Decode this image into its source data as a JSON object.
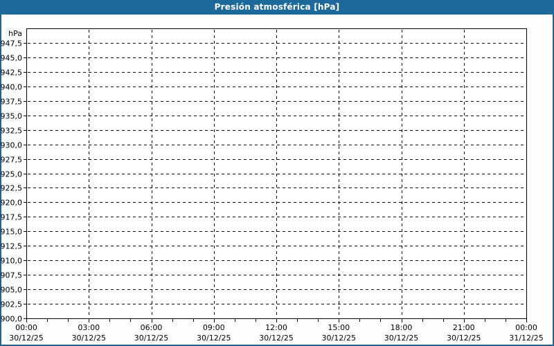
{
  "window": {
    "title": "Presión atmosférica [hPa]"
  },
  "colors": {
    "titlebar_bg": "#1e699b",
    "titlebar_text": "#ffffff",
    "border": "#24618f",
    "panel_bg": "#fbfdfe",
    "plot_bg": "#ffffff",
    "grid": "#000000",
    "axis": "#000000",
    "text": "#000000"
  },
  "chart_data": {
    "type": "line",
    "title": "Presión atmosférica [hPa]",
    "xlabel": "",
    "ylabel": "hPa",
    "ylim": [
      900,
      950
    ],
    "y_tick_step": 2.5,
    "y_tick_labels": [
      "947,5",
      "945,0",
      "942,5",
      "940,0",
      "937,5",
      "935,0",
      "932,5",
      "930,0",
      "927,5",
      "925,0",
      "922,5",
      "920,0",
      "917,5",
      "915,0",
      "912,5",
      "910,0",
      "907,5",
      "905,0",
      "902,5",
      "900,0"
    ],
    "x_range_hours": [
      0,
      24
    ],
    "x_hour_step": 3,
    "x_minor_hour_step": 1,
    "x_ticks": [
      {
        "time": "00:00",
        "date": "30/12/25"
      },
      {
        "time": "03:00",
        "date": "30/12/25"
      },
      {
        "time": "06:00",
        "date": "30/12/25"
      },
      {
        "time": "09:00",
        "date": "30/12/25"
      },
      {
        "time": "12:00",
        "date": "30/12/25"
      },
      {
        "time": "15:00",
        "date": "30/12/25"
      },
      {
        "time": "18:00",
        "date": "30/12/25"
      },
      {
        "time": "21:00",
        "date": "30/12/25"
      },
      {
        "time": "00:00",
        "date": "31/12/25"
      }
    ],
    "grid": "dashed",
    "legend": null,
    "series": []
  }
}
